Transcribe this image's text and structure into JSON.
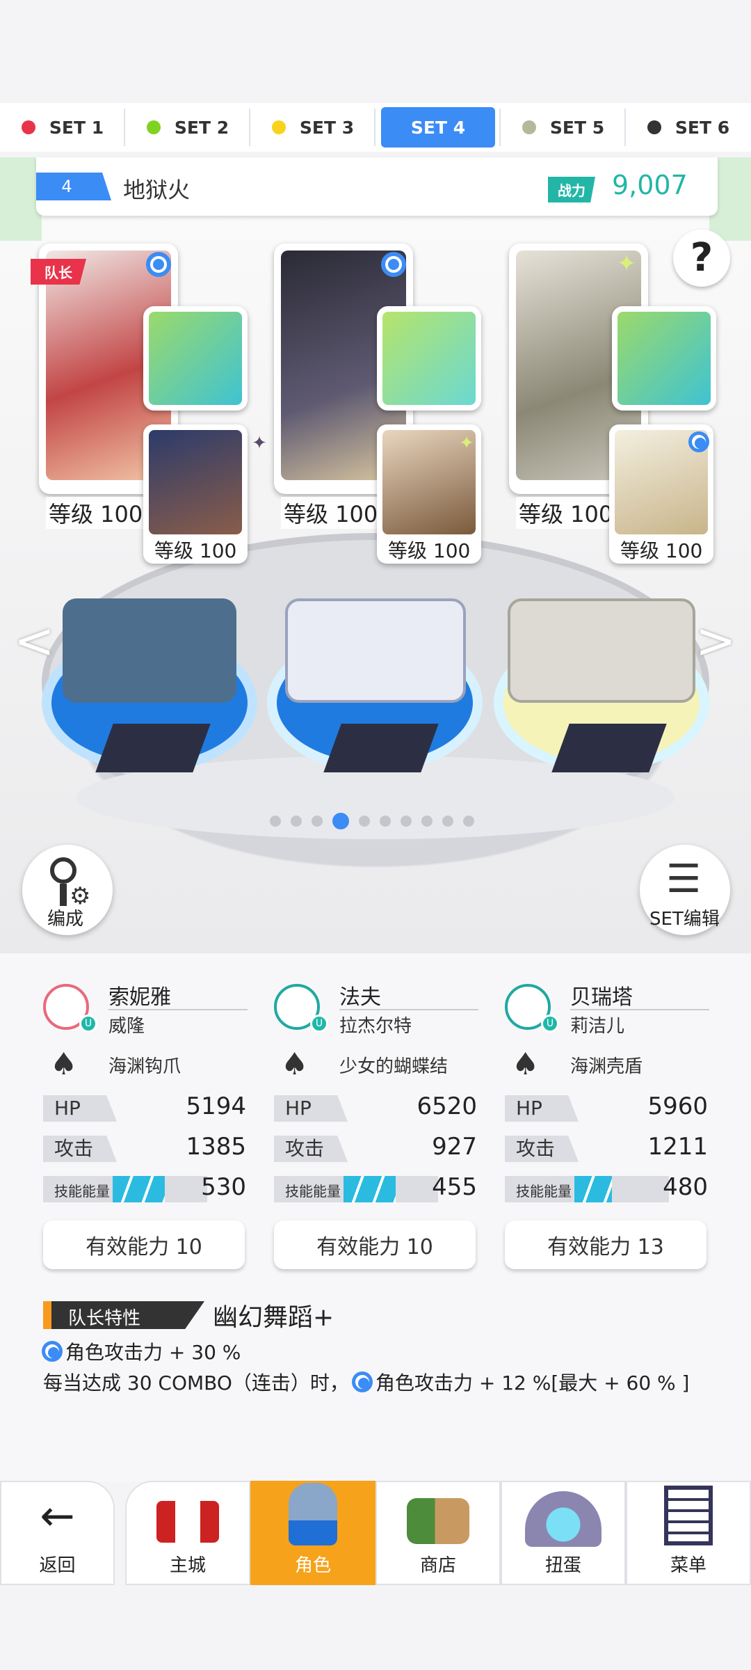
{
  "tabs": [
    {
      "label": "SET 1",
      "color": "#e8334a"
    },
    {
      "label": "SET 2",
      "color": "#7ed321"
    },
    {
      "label": "SET 3",
      "color": "#f8d21c"
    },
    {
      "label": "SET 4",
      "color": "#3b8cf5",
      "active": true
    },
    {
      "label": "SET 5",
      "color": "#b5b89a"
    },
    {
      "label": "SET 6",
      "color": "#333333"
    }
  ],
  "team": {
    "number": "4",
    "name": "地狱火",
    "power_label": "战力",
    "power_value": "9,007"
  },
  "cards": [
    {
      "level": "等级 100",
      "sub_level": "等级 100",
      "leader": "队长"
    },
    {
      "level": "等级 100",
      "sub_level": "等级 100"
    },
    {
      "level": "等级 100",
      "sub_level": "等级 100"
    }
  ],
  "help_symbol": "?",
  "buttons": {
    "formation": "编成",
    "set_edit": "SET编辑"
  },
  "members": [
    {
      "name": "索妮雅",
      "sub": "威隆",
      "weapon": "海渊钩爪",
      "hp": "5194",
      "atk": "1385",
      "skill": "530",
      "skill_fill": 0.55,
      "effective": "有效能力 10",
      "avatar_color": "#e8697b",
      "u": "U"
    },
    {
      "name": "法夫",
      "sub": "拉杰尔特",
      "weapon": "少女的蝴蝶结",
      "hp": "6520",
      "atk": "927",
      "skill": "455",
      "skill_fill": 0.55,
      "effective": "有效能力 10",
      "avatar_color": "#22a8a0",
      "u": "U"
    },
    {
      "name": "贝瑞塔",
      "sub": "莉洁儿",
      "weapon": "海渊壳盾",
      "hp": "5960",
      "atk": "1211",
      "skill": "480",
      "skill_fill": 0.4,
      "effective": "有效能力 13",
      "avatar_color": "#22a8a0",
      "u": "U"
    }
  ],
  "labels": {
    "hp": "HP",
    "atk": "攻击",
    "skill": "技能能量"
  },
  "leader": {
    "tag": "队长特性",
    "title": "幽幻舞蹈+",
    "line1": "角色攻击力 + 30 %",
    "line2a": "每当达成 30 COMBO（连击）时，",
    "line2b": "角色攻击力 + 12 %[最大 + 60 % ]"
  },
  "pager": {
    "count": 10,
    "active": 3
  },
  "nav": [
    {
      "label": "返回",
      "icon": "back-arrow-icon"
    },
    {
      "label": "主城",
      "icon": "castle-icon"
    },
    {
      "label": "角色",
      "icon": "character-icon",
      "active": true
    },
    {
      "label": "商店",
      "icon": "shop-icon"
    },
    {
      "label": "扭蛋",
      "icon": "gacha-icon"
    },
    {
      "label": "菜单",
      "icon": "menu-icon"
    }
  ]
}
